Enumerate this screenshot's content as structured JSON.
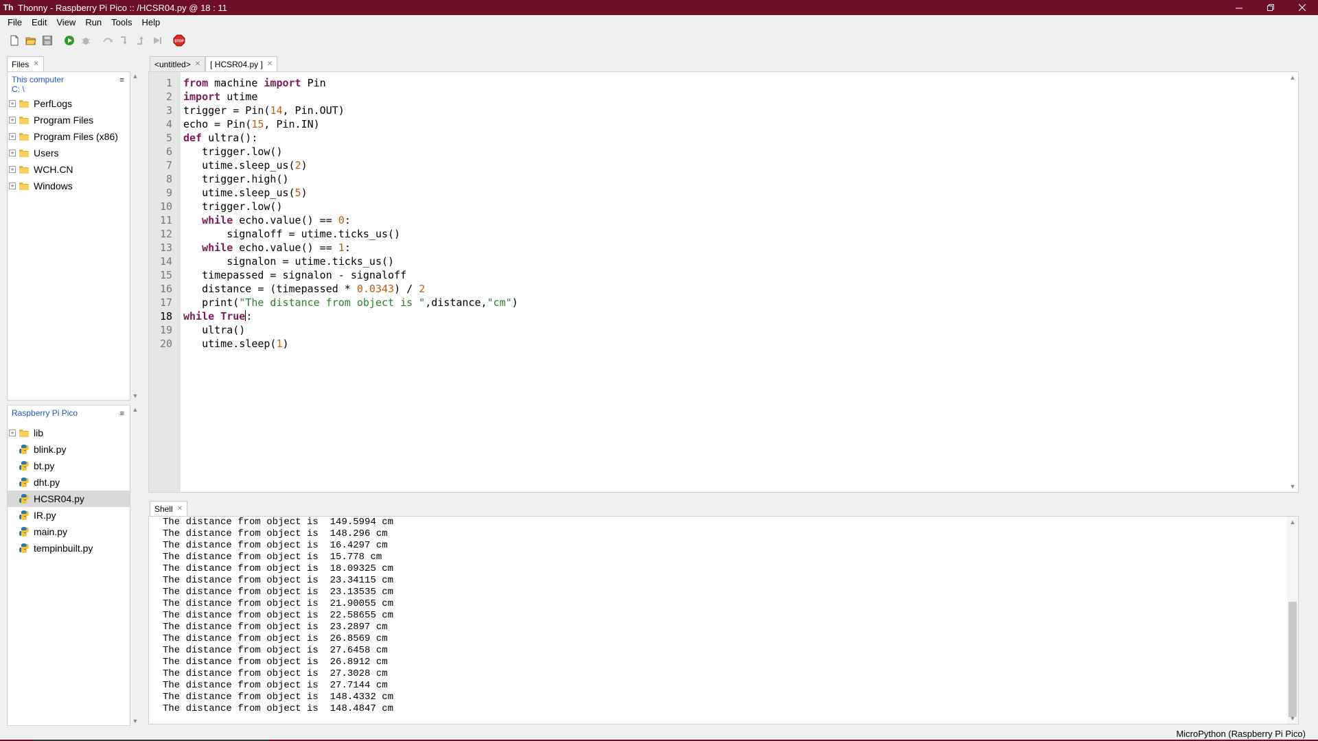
{
  "window": {
    "title": "Thonny  -  Raspberry Pi Pico :: /HCSR04.py  @  18 : 11",
    "controls": [
      "minimize",
      "restore",
      "close"
    ]
  },
  "menu": [
    "File",
    "Edit",
    "View",
    "Run",
    "Tools",
    "Help"
  ],
  "toolbar": [
    {
      "name": "new-file-icon"
    },
    {
      "name": "open-file-icon"
    },
    {
      "name": "save-icon"
    },
    {
      "name": "run-icon"
    },
    {
      "name": "debug-icon"
    },
    {
      "name": "step-over-icon"
    },
    {
      "name": "step-into-icon"
    },
    {
      "name": "step-out-icon"
    },
    {
      "name": "resume-icon"
    },
    {
      "name": "stop-icon",
      "label": "STOP"
    }
  ],
  "files_pane": {
    "tab_label": "Files",
    "location": "This computer",
    "path": "C: \\",
    "items": [
      "PerfLogs",
      "Program Files",
      "Program Files (x86)",
      "Users",
      "WCH.CN",
      "Windows"
    ]
  },
  "pico_pane": {
    "location": "Raspberry Pi Pico",
    "items": [
      {
        "label": "lib",
        "type": "folder"
      },
      {
        "label": "blink.py",
        "type": "python"
      },
      {
        "label": "bt.py",
        "type": "python"
      },
      {
        "label": "dht.py",
        "type": "python"
      },
      {
        "label": "HCSR04.py",
        "type": "python",
        "selected": true
      },
      {
        "label": "IR.py",
        "type": "python"
      },
      {
        "label": "main.py",
        "type": "python"
      },
      {
        "label": "tempinbuilt.py",
        "type": "python"
      }
    ]
  },
  "editor": {
    "tabs": [
      {
        "label": "<untitled>",
        "active": false
      },
      {
        "label": "[ HCSR04.py ]",
        "active": true
      }
    ],
    "current_line": 18,
    "lines": [
      "from machine import Pin",
      "import utime",
      "trigger = Pin(14, Pin.OUT)",
      "echo = Pin(15, Pin.IN)",
      "def ultra():",
      "   trigger.low()",
      "   utime.sleep_us(2)",
      "   trigger.high()",
      "   utime.sleep_us(5)",
      "   trigger.low()",
      "   while echo.value() == 0:",
      "       signaloff = utime.ticks_us()",
      "   while echo.value() == 1:",
      "       signalon = utime.ticks_us()",
      "   timepassed = signalon - signaloff",
      "   distance = (timepassed * 0.0343) / 2",
      "   print(\"The distance from object is \",distance,\"cm\")",
      "while True:",
      "   ultra()",
      "   utime.sleep(1)"
    ]
  },
  "shell": {
    "tab_label": "Shell",
    "output": [
      "The distance from object is  149.5994 cm",
      "The distance from object is  148.296 cm",
      "The distance from object is  16.4297 cm",
      "The distance from object is  15.778 cm",
      "The distance from object is  18.09325 cm",
      "The distance from object is  23.34115 cm",
      "The distance from object is  23.13535 cm",
      "The distance from object is  21.90055 cm",
      "The distance from object is  22.58655 cm",
      "The distance from object is  23.2897 cm",
      "The distance from object is  26.8569 cm",
      "The distance from object is  27.6458 cm",
      "The distance from object is  26.8912 cm",
      "The distance from object is  27.3028 cm",
      "The distance from object is  27.7144 cm",
      "The distance from object is  148.4332 cm",
      "The distance from object is  148.4847 cm"
    ]
  },
  "status": {
    "interpreter": "MicroPython (Raspberry Pi Pico)"
  },
  "colors": {
    "titlebar": "#6c0f27",
    "keyword": "#7a1b58",
    "number": "#c2590c",
    "string": "#2d7d2d",
    "location_link": "#1b56c9"
  }
}
